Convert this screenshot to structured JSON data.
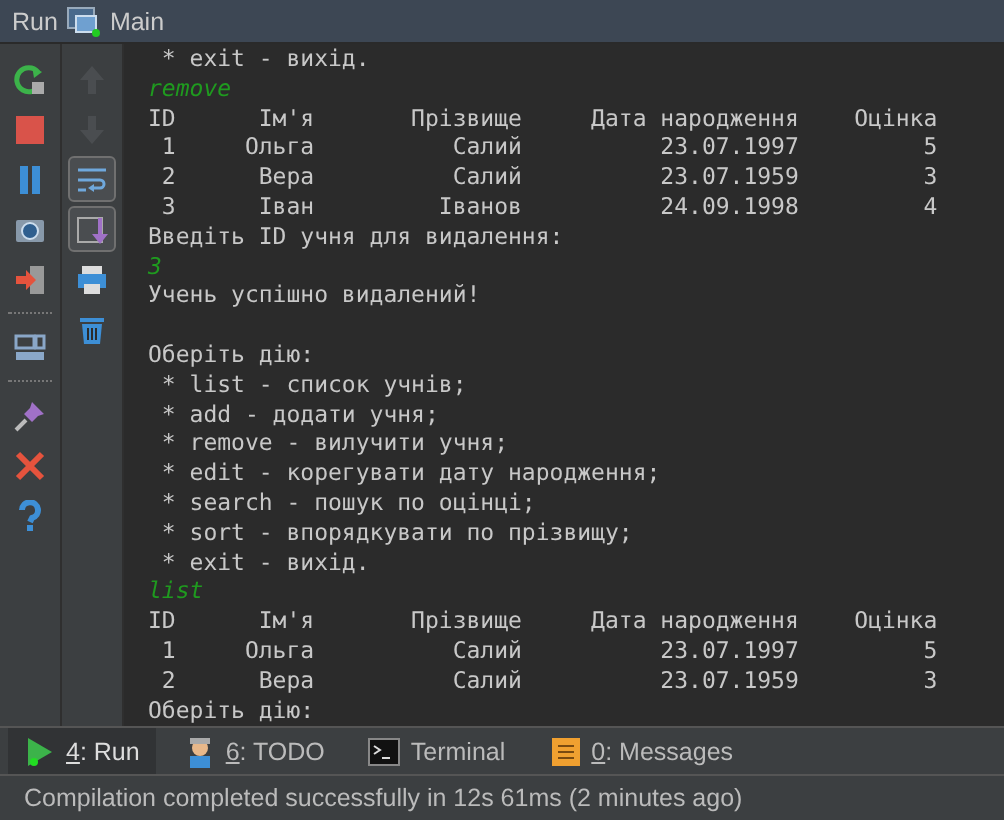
{
  "window": {
    "title": "Run",
    "tab": "Main"
  },
  "main_toolbar": [
    {
      "kind": "rerun"
    },
    {
      "kind": "stop"
    },
    {
      "kind": "pause"
    },
    {
      "kind": "camera"
    },
    {
      "kind": "exit"
    },
    {
      "kind": "separator"
    },
    {
      "kind": "layout"
    },
    {
      "kind": "separator"
    },
    {
      "kind": "pin"
    },
    {
      "kind": "close"
    },
    {
      "kind": "help"
    }
  ],
  "side_toolbar": [
    {
      "kind": "up",
      "disabled": true,
      "toggled": false
    },
    {
      "kind": "down",
      "disabled": true,
      "toggled": false
    },
    {
      "kind": "wrap",
      "disabled": false,
      "toggled": true
    },
    {
      "kind": "scroll",
      "disabled": false,
      "toggled": true
    },
    {
      "kind": "print",
      "disabled": false,
      "toggled": false
    },
    {
      "kind": "trash",
      "disabled": false,
      "toggled": false
    }
  ],
  "console": [
    {
      "kind": "output",
      "text": " * exit - вихід."
    },
    {
      "kind": "input",
      "text": "remove"
    },
    {
      "kind": "output",
      "text": "ID      Ім'я       Прізвище     Дата народження    Оцінка"
    },
    {
      "kind": "output",
      "text": " 1     Ольга          Салий          23.07.1997         5"
    },
    {
      "kind": "output",
      "text": " 2      Вера          Салий          23.07.1959         3"
    },
    {
      "kind": "output",
      "text": " 3      Іван         Іванов          24.09.1998         4"
    },
    {
      "kind": "output",
      "text": "Введіть ID учня для видалення:"
    },
    {
      "kind": "input",
      "text": "3"
    },
    {
      "kind": "output",
      "text": "Учень успішно видалений!"
    },
    {
      "kind": "blank"
    },
    {
      "kind": "output",
      "text": "Оберіть дію:"
    },
    {
      "kind": "output",
      "text": " * list - список учнів;"
    },
    {
      "kind": "output",
      "text": " * add - додати учня;"
    },
    {
      "kind": "output",
      "text": " * remove - вилучити учня;"
    },
    {
      "kind": "output",
      "text": " * edit - корегувати дату народження;"
    },
    {
      "kind": "output",
      "text": " * search - пошук по оцінці;"
    },
    {
      "kind": "output",
      "text": " * sort - впорядкувати по прізвищу;"
    },
    {
      "kind": "output",
      "text": " * exit - вихід."
    },
    {
      "kind": "input",
      "text": "list"
    },
    {
      "kind": "output",
      "text": "ID      Ім'я       Прізвище     Дата народження    Оцінка"
    },
    {
      "kind": "output",
      "text": " 1     Ольга          Салий          23.07.1997         5"
    },
    {
      "kind": "output",
      "text": " 2      Вера          Салий          23.07.1959         3"
    },
    {
      "kind": "output",
      "text": "Оберіть дію:"
    }
  ],
  "bottom_tabs": [
    {
      "kind": "run",
      "label": "4: Run",
      "underline": true,
      "selected": true
    },
    {
      "kind": "todo",
      "label": "6: TODO",
      "underline": true,
      "selected": false
    },
    {
      "kind": "terminal",
      "label": "Terminal",
      "underline": false,
      "selected": false
    },
    {
      "kind": "messages",
      "label": "0: Messages",
      "underline": true,
      "selected": false
    }
  ],
  "status_bar": "Compilation completed successfully in 12s 61ms (2 minutes ago)"
}
